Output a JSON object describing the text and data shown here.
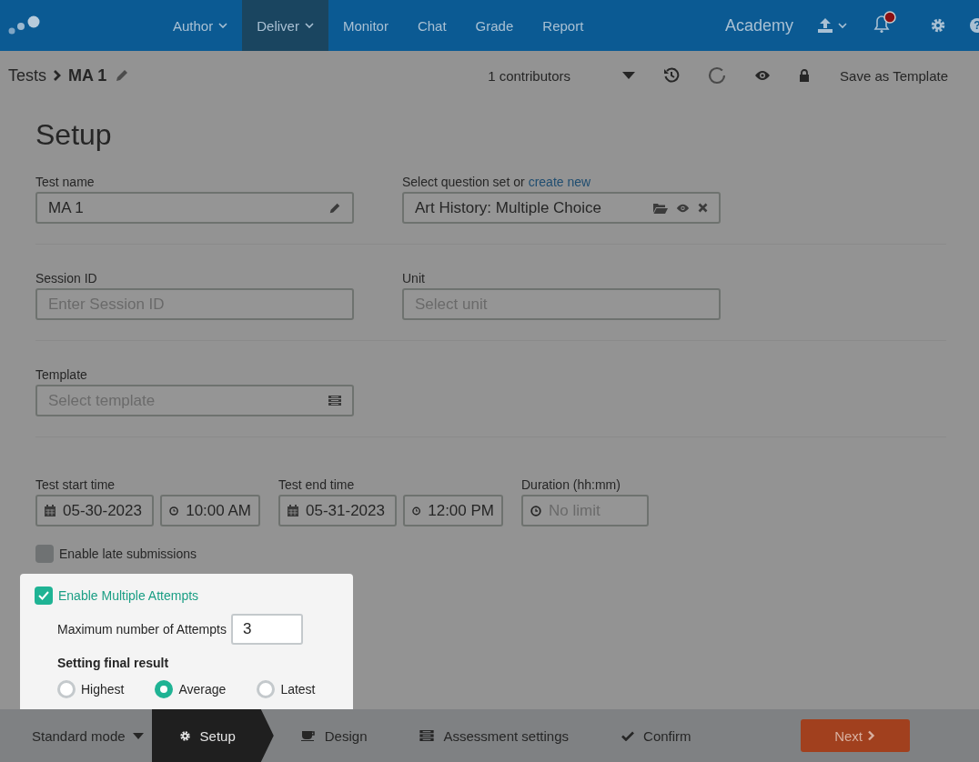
{
  "nav": {
    "items": [
      {
        "label": "Author",
        "caret": true,
        "selected": false
      },
      {
        "label": "Deliver",
        "caret": true,
        "selected": true
      },
      {
        "label": "Monitor",
        "caret": false,
        "selected": false
      },
      {
        "label": "Chat",
        "caret": false,
        "selected": false
      },
      {
        "label": "Grade",
        "caret": false,
        "selected": false
      },
      {
        "label": "Report",
        "caret": false,
        "selected": false
      }
    ],
    "brand": "Academy",
    "notification": true,
    "help": "?"
  },
  "toolbar": {
    "breadcrumb": "Tests",
    "current": "MA 1",
    "contributors": "1 contributors",
    "save": "Save as Template"
  },
  "heading": "Setup",
  "test_name": {
    "label": "Test name",
    "value": "MA 1"
  },
  "question_set": {
    "label": "Select question set or",
    "link": "create new",
    "value": "Art History: Multiple Choice"
  },
  "session_id": {
    "label": "Session ID",
    "placeholder": "Enter Session ID"
  },
  "unit": {
    "label": "Unit",
    "placeholder": "Select unit"
  },
  "template": {
    "label": "Template",
    "placeholder": "Select template"
  },
  "start": {
    "label": "Test start time",
    "date": "05-30-2023",
    "time": "10:00 AM"
  },
  "end": {
    "label": "Test end time",
    "date": "05-31-2023",
    "time": "12:00 PM"
  },
  "duration": {
    "label": "Duration (hh:mm)",
    "placeholder": "No limit"
  },
  "late": {
    "label": "Enable late submissions",
    "checked": false
  },
  "attempts": {
    "label": "Enable Multiple Attempts",
    "checked": true,
    "max_label": "Maximum number of Attempts",
    "max_value": "3",
    "result_heading": "Setting final result",
    "options": [
      {
        "label": "Highest",
        "selected": false
      },
      {
        "label": "Average",
        "selected": true
      },
      {
        "label": "Latest",
        "selected": false
      }
    ]
  },
  "footer": {
    "mode": "Standard mode",
    "steps": [
      {
        "label": "Setup",
        "selected": true
      },
      {
        "label": "Design",
        "selected": false
      },
      {
        "label": "Assessment settings",
        "selected": false
      },
      {
        "label": "Confirm",
        "selected": false
      }
    ],
    "next": "Next"
  }
}
